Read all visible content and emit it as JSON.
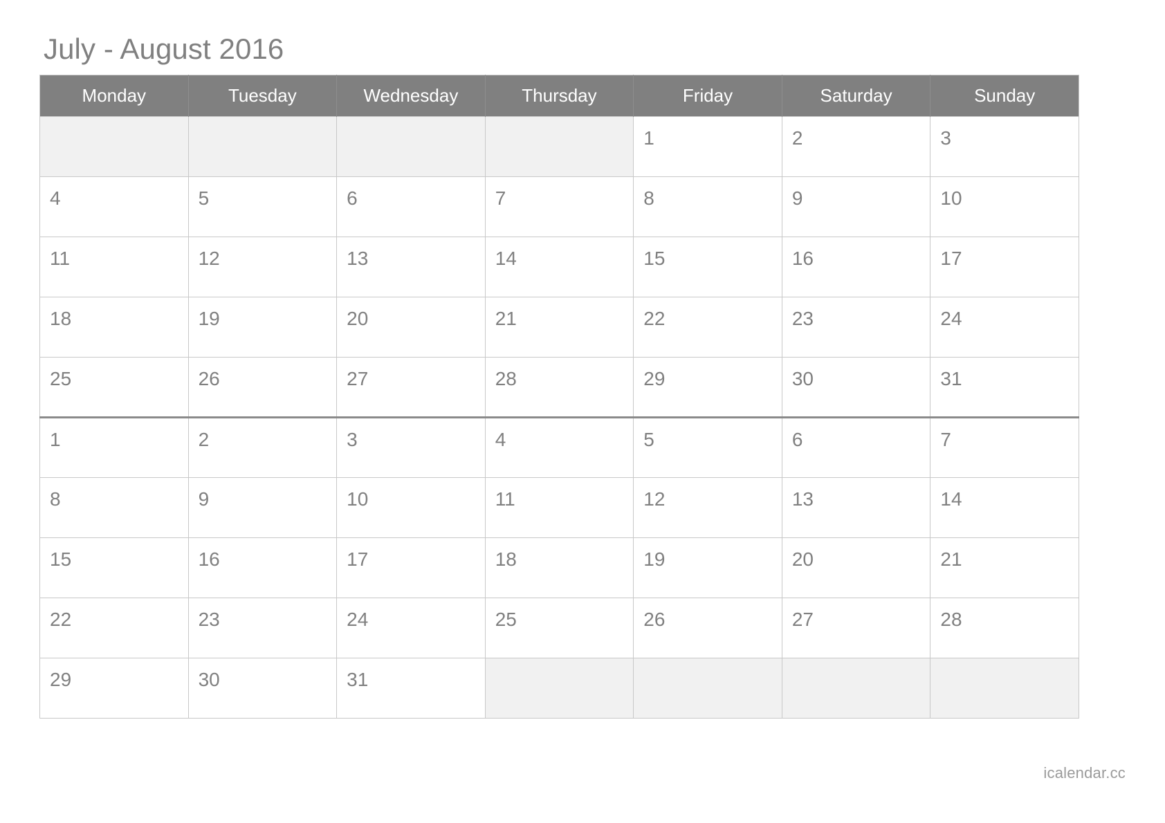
{
  "calendar": {
    "title": "July - August 2016",
    "weekday_headers": [
      "Monday",
      "Tuesday",
      "Wednesday",
      "Thursday",
      "Friday",
      "Saturday",
      "Sunday"
    ],
    "watermark": "icalendar.cc",
    "colors": {
      "header_bg": "#808080",
      "header_text": "#ffffff",
      "blank_cell_bg": "#f1f1f1",
      "cell_bg": "#ffffff",
      "grid_border": "#c8c8c8",
      "month_divider": "#8a8a8a",
      "text": "#808080",
      "watermark_text": "#9a9a9a"
    },
    "weeks": [
      {
        "month_end": false,
        "days": [
          "",
          "",
          "",
          "",
          "1",
          "2",
          "3"
        ]
      },
      {
        "month_end": false,
        "days": [
          "4",
          "5",
          "6",
          "7",
          "8",
          "9",
          "10"
        ]
      },
      {
        "month_end": false,
        "days": [
          "11",
          "12",
          "13",
          "14",
          "15",
          "16",
          "17"
        ]
      },
      {
        "month_end": false,
        "days": [
          "18",
          "19",
          "20",
          "21",
          "22",
          "23",
          "24"
        ]
      },
      {
        "month_end": true,
        "days": [
          "25",
          "26",
          "27",
          "28",
          "29",
          "30",
          "31"
        ]
      },
      {
        "month_end": false,
        "days": [
          "1",
          "2",
          "3",
          "4",
          "5",
          "6",
          "7"
        ]
      },
      {
        "month_end": false,
        "days": [
          "8",
          "9",
          "10",
          "11",
          "12",
          "13",
          "14"
        ]
      },
      {
        "month_end": false,
        "days": [
          "15",
          "16",
          "17",
          "18",
          "19",
          "20",
          "21"
        ]
      },
      {
        "month_end": false,
        "days": [
          "22",
          "23",
          "24",
          "25",
          "26",
          "27",
          "28"
        ]
      },
      {
        "month_end": false,
        "days": [
          "29",
          "30",
          "31",
          "",
          "",
          "",
          ""
        ]
      }
    ]
  }
}
